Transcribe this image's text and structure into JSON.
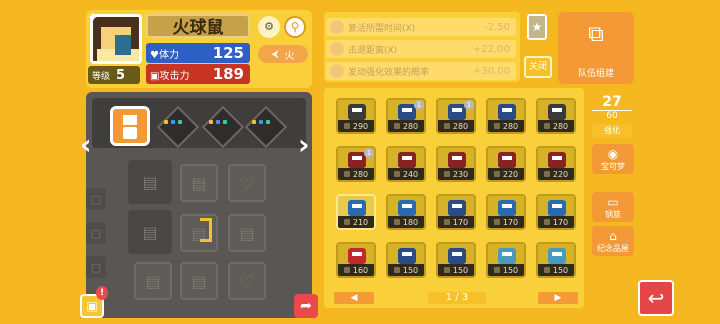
{
  "pokemon": {
    "name": "火球鼠",
    "level_label": "等级",
    "level": "5",
    "hp_label": "体力",
    "hp": "125",
    "atk_label": "攻击力",
    "atk": "189",
    "type_label": "火"
  },
  "effects": [
    {
      "label": "复活所需时间(X)",
      "value": "-2.50"
    },
    {
      "label": "击退距离(X)",
      "value": "+22.00"
    },
    {
      "label": "发动强化效果的概率",
      "value": "+30.00"
    }
  ],
  "buttons": {
    "close": "关闭",
    "team_build": "队伍组建",
    "expand": "强化",
    "treasure": "宝可梦",
    "cook": "锅篮",
    "gallery": "纪念品屋"
  },
  "box": {
    "count_current": "27",
    "count_max": "60",
    "page": "1 / 3",
    "prev": "◀",
    "next": "▶",
    "monsters": [
      {
        "power": "290",
        "color": "#3a3a3a",
        "badge": ""
      },
      {
        "power": "280",
        "color": "#2a4a8a",
        "badge": "1"
      },
      {
        "power": "280",
        "color": "#2a4a8a",
        "badge": "1"
      },
      {
        "power": "280",
        "color": "#2a4a8a",
        "badge": ""
      },
      {
        "power": "280",
        "color": "#3a3a3a",
        "badge": ""
      },
      {
        "power": "280",
        "color": "#8a2222",
        "badge": "1"
      },
      {
        "power": "240",
        "color": "#8a2222",
        "badge": ""
      },
      {
        "power": "230",
        "color": "#8a2222",
        "badge": ""
      },
      {
        "power": "220",
        "color": "#8a2222",
        "badge": ""
      },
      {
        "power": "220",
        "color": "#8a2222",
        "badge": ""
      },
      {
        "power": "210",
        "color": "#2a6ab0",
        "badge": ""
      },
      {
        "power": "180",
        "color": "#2a6ab0",
        "badge": ""
      },
      {
        "power": "170",
        "color": "#2a4a8a",
        "badge": ""
      },
      {
        "power": "170",
        "color": "#2a6ab0",
        "badge": ""
      },
      {
        "power": "170",
        "color": "#2a6ab0",
        "badge": ""
      },
      {
        "power": "160",
        "color": "#c02a2a",
        "badge": ""
      },
      {
        "power": "150",
        "color": "#2a4a8a",
        "badge": ""
      },
      {
        "power": "150",
        "color": "#2a4a8a",
        "badge": ""
      },
      {
        "power": "150",
        "color": "#4a9ac0",
        "badge": ""
      },
      {
        "power": "150",
        "color": "#4a9ac0",
        "badge": ""
      }
    ]
  },
  "colors": {
    "background": "#f5b820",
    "accent_orange": "#f39a37",
    "hp_blue": "#2d5fc4",
    "atk_red": "#c73424"
  }
}
